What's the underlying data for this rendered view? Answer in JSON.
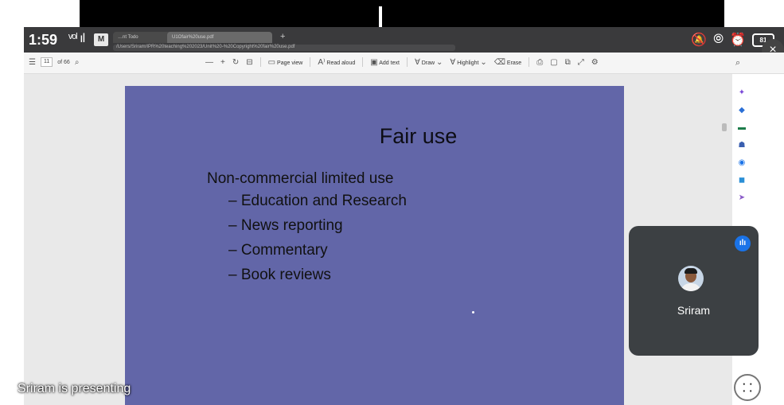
{
  "status": {
    "time": "1:59",
    "signal": "ᵛᵒˡ ıl",
    "app_badge": "M",
    "battery": "81"
  },
  "browser": {
    "tabs": [
      {
        "label": "…nt Todo"
      },
      {
        "label": "U1Ofair%20use.pdf"
      }
    ],
    "new_tab": "+",
    "url": "/Users/Sriram/IPR%20teaching%202023/Unit%20-%20Copyright%20fair%20use.pdf",
    "close": "×"
  },
  "pdf_toolbar": {
    "page_current": "11",
    "page_total": "of 66",
    "zoom_out": "—",
    "zoom_in": "+",
    "page_view": "Page view",
    "read_aloud": "Read aloud",
    "add_text": "Add text",
    "draw": "Draw",
    "highlight": "Highlight",
    "erase": "Erase"
  },
  "slide": {
    "title": "Fair use",
    "main_point": "Non-commercial limited use",
    "sub_points": [
      "– Education and Research",
      "– News reporting",
      "– Commentary",
      "– Book reviews"
    ]
  },
  "participant": {
    "name": "Sriram",
    "speaking_icon": "audio-level-icon"
  },
  "caption": "Sriram is presenting",
  "colors": {
    "slide_bg": "#6266a8",
    "tile_bg": "#3c4043",
    "accent": "#1a73e8"
  }
}
